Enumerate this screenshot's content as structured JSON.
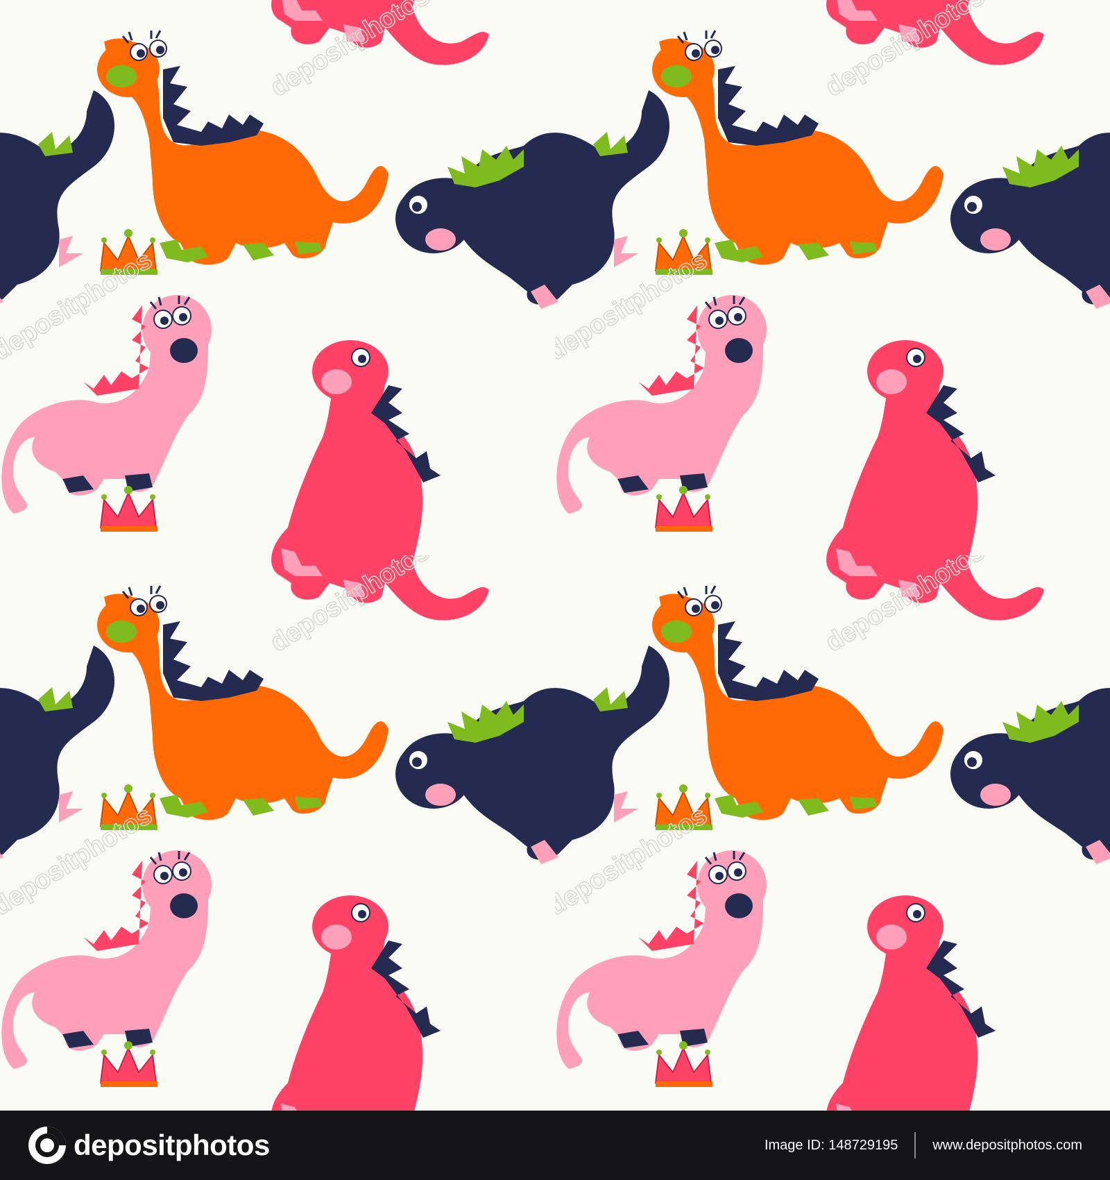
{
  "colors": {
    "background": "#fbfbf6",
    "orange": "#ff6a06",
    "navy": "#252a50",
    "green": "#7fbb1e",
    "hot_pink": "#fe4367",
    "light_pink": "#fea0b9",
    "footer": "#151518"
  },
  "pattern": {
    "motif": "cartoon dinosaurs",
    "characters": [
      "orange dinosaur with crown",
      "navy dinosaur",
      "light pink dinosaur with crown",
      "hot pink dinosaur"
    ],
    "watermark": "depositphotos"
  },
  "footer": {
    "brand": "depositphotos",
    "image_id": "Image ID: 148729195",
    "url": "www.depositphotos.com",
    "logo_icon": "camera-lens-icon"
  }
}
